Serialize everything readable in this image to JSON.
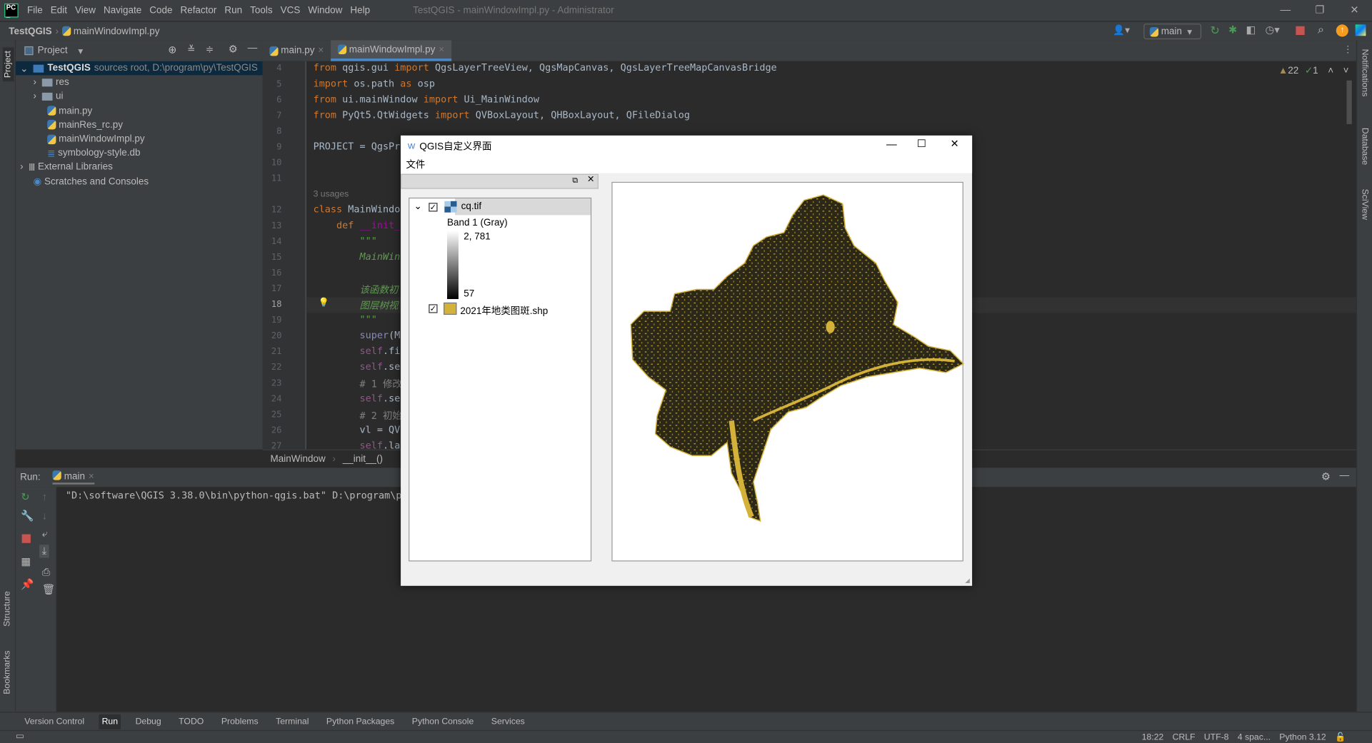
{
  "ide": {
    "menu": [
      "File",
      "Edit",
      "View",
      "Navigate",
      "Code",
      "Refactor",
      "Run",
      "Tools",
      "VCS",
      "Window",
      "Help"
    ],
    "window_title": "TestQGIS - mainWindowImpl.py - Administrator",
    "breadcrumb": {
      "project": "TestQGIS",
      "file": "mainWindowImpl.py"
    },
    "run_config": "main",
    "project_panel": {
      "title": "Project",
      "root": {
        "name": "TestQGIS",
        "hint": "sources root, D:\\program\\py\\TestQGIS"
      },
      "items": [
        "res",
        "ui",
        "main.py",
        "mainRes_rc.py",
        "mainWindowImpl.py",
        "symbology-style.db",
        "External Libraries",
        "Scratches and Consoles"
      ]
    },
    "tabs": [
      {
        "label": "main.py",
        "active": false
      },
      {
        "label": "mainWindowImpl.py",
        "active": true
      }
    ],
    "inspections": {
      "warnings": "22",
      "ok": "1"
    },
    "usages_hint": "3 usages",
    "code": [
      {
        "n": "4",
        "t": [
          [
            "kw",
            "from "
          ],
          [
            "",
            "qgis.gui "
          ],
          [
            "kw",
            "import "
          ],
          [
            "",
            "QgsLayerTreeView, QgsMapCanvas, QgsLayerTreeMapCanvasBridge"
          ]
        ]
      },
      {
        "n": "5",
        "t": [
          [
            "kw",
            "import "
          ],
          [
            "",
            "os.path "
          ],
          [
            "kw",
            "as "
          ],
          [
            "",
            "osp"
          ]
        ]
      },
      {
        "n": "6",
        "t": [
          [
            "kw",
            "from "
          ],
          [
            "",
            "ui.mainWindow "
          ],
          [
            "kw",
            "import "
          ],
          [
            "",
            "Ui_MainWindow"
          ]
        ]
      },
      {
        "n": "7",
        "t": [
          [
            "kw",
            "from "
          ],
          [
            "",
            "PyQt5.QtWidgets "
          ],
          [
            "kw",
            "import "
          ],
          [
            "",
            "QVBoxLayout, QHBoxLayout, QFileDialog"
          ]
        ]
      },
      {
        "n": "8",
        "t": []
      },
      {
        "n": "9",
        "t": [
          [
            "",
            "PROJECT = QgsPr"
          ]
        ]
      },
      {
        "n": "10",
        "t": []
      },
      {
        "n": "11",
        "t": []
      },
      {
        "n": "12",
        "t": [
          [
            "kw",
            "class "
          ],
          [
            "",
            "MainWindo"
          ]
        ]
      },
      {
        "n": "13",
        "t": [
          [
            "",
            "    "
          ],
          [
            "kw",
            "def "
          ],
          [
            "fn",
            "__init_"
          ]
        ]
      },
      {
        "n": "14",
        "t": [
          [
            "doc",
            "        \"\"\""
          ]
        ]
      },
      {
        "n": "15",
        "t": [
          [
            "doc",
            "        MainWin"
          ]
        ]
      },
      {
        "n": "16",
        "t": []
      },
      {
        "n": "17",
        "t": [
          [
            "doc",
            "        该函数初"
          ]
        ]
      },
      {
        "n": "18",
        "t": [
          [
            "doc",
            "        图层树视"
          ]
        ]
      },
      {
        "n": "19",
        "t": [
          [
            "doc",
            "        \"\"\""
          ]
        ]
      },
      {
        "n": "20",
        "t": [
          [
            "",
            "        "
          ],
          [
            "bi",
            "super"
          ],
          [
            "",
            "(M"
          ]
        ]
      },
      {
        "n": "21",
        "t": [
          [
            "",
            "        "
          ],
          [
            "self",
            "self"
          ],
          [
            "",
            ".fi"
          ]
        ]
      },
      {
        "n": "22",
        "t": [
          [
            "",
            "        "
          ],
          [
            "self",
            "self"
          ],
          [
            "",
            ".se"
          ]
        ]
      },
      {
        "n": "23",
        "t": [
          [
            "cm",
            "        # 1 修改"
          ]
        ]
      },
      {
        "n": "24",
        "t": [
          [
            "",
            "        "
          ],
          [
            "self",
            "self"
          ],
          [
            "",
            ".se"
          ]
        ]
      },
      {
        "n": "25",
        "t": [
          [
            "cm",
            "        # 2 初始"
          ]
        ]
      },
      {
        "n": "26",
        "t": [
          [
            "",
            "        vl = QV"
          ]
        ]
      },
      {
        "n": "27",
        "t": [
          [
            "",
            "        "
          ],
          [
            "self",
            "self"
          ],
          [
            "",
            ".la"
          ]
        ]
      }
    ],
    "code_breadcrumb": [
      "MainWindow",
      "__init__()"
    ],
    "run": {
      "label": "Run:",
      "tab": "main",
      "output": "\"D:\\software\\QGIS 3.38.0\\bin\\python-qgis.bat\" D:\\program\\py"
    },
    "tool_windows": [
      "Version Control",
      "Run",
      "Debug",
      "TODO",
      "Problems",
      "Terminal",
      "Python Packages",
      "Python Console",
      "Services"
    ],
    "active_tool_window": "Run",
    "side_tools_left": [
      "Project",
      "Structure",
      "Bookmarks"
    ],
    "side_tools_right": [
      "Notifications",
      "Database",
      "SciView"
    ],
    "status": [
      "18:22",
      "CRLF",
      "UTF-8",
      "4 spac...",
      "Python 3.12"
    ]
  },
  "qgis": {
    "title": "QGIS自定义界面",
    "menu": [
      "文件"
    ],
    "layers": [
      {
        "name": "cq.tif",
        "checked": true,
        "legend_title": "Band 1 (Gray)",
        "max": "2, 781",
        "min": "57"
      },
      {
        "name": "2021年地类图斑.shp",
        "checked": true,
        "color": "#d4b23a"
      }
    ]
  },
  "colors": {
    "accent": "#4a88c7",
    "polygon_fill": "#d4b23a",
    "stop": "#c75450",
    "run_green": "#499c54"
  }
}
